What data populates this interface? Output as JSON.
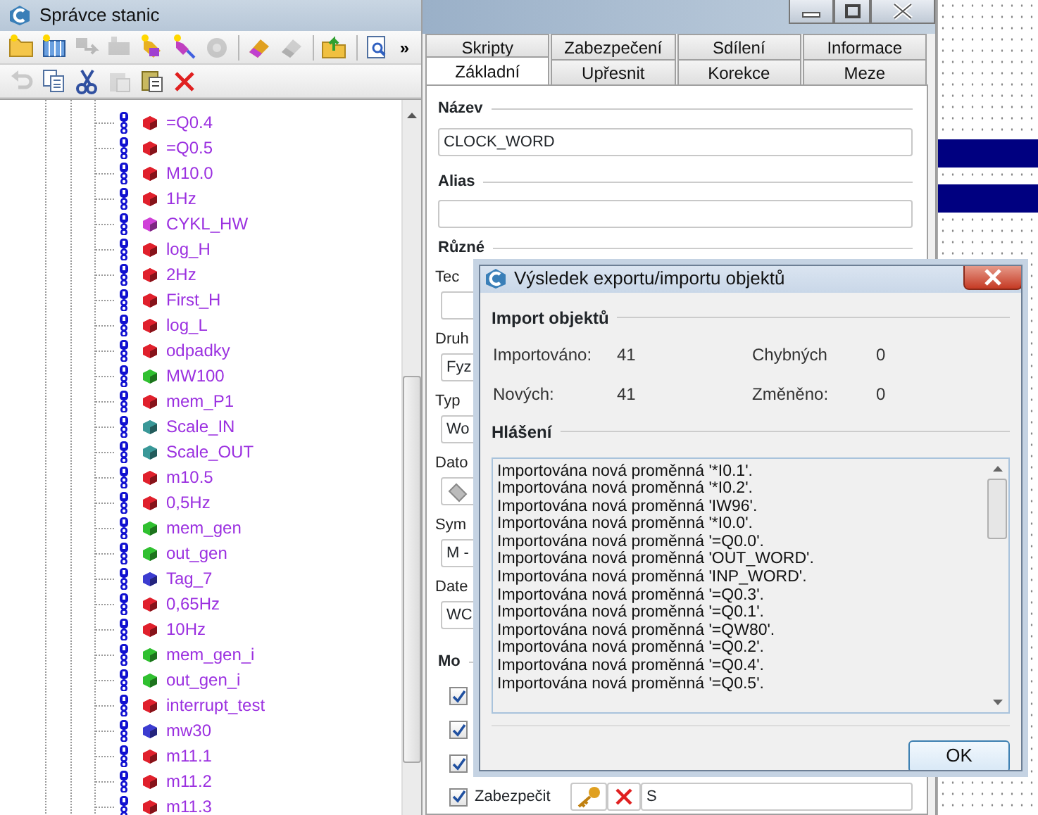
{
  "stations_window": {
    "title": "Správce stanic",
    "toolbar_1": [
      {
        "kind": "folder",
        "disabled": false
      },
      {
        "kind": "station",
        "disabled": false
      },
      {
        "kind": "transfer",
        "disabled": true
      },
      {
        "kind": "device",
        "disabled": true
      },
      {
        "kind": "tags",
        "disabled": false
      },
      {
        "kind": "tag-add",
        "disabled": false
      },
      {
        "kind": "dot",
        "disabled": true
      },
      {
        "kind": "separator"
      },
      {
        "kind": "eraser",
        "disabled": false
      },
      {
        "kind": "eraser",
        "disabled": true
      },
      {
        "kind": "separator"
      },
      {
        "kind": "open",
        "disabled": false
      },
      {
        "kind": "separator"
      },
      {
        "kind": "preview",
        "disabled": false
      },
      {
        "kind": "more",
        "text": "»"
      }
    ],
    "toolbar_2": [
      {
        "kind": "undo",
        "disabled": true
      },
      {
        "kind": "copy",
        "disabled": false
      },
      {
        "kind": "cut",
        "disabled": false
      },
      {
        "kind": "paste",
        "disabled": true
      },
      {
        "kind": "paste-special",
        "disabled": false
      },
      {
        "kind": "delete",
        "disabled": false
      }
    ],
    "tree_items": [
      {
        "label": "=Q0.4",
        "color": "#e0202c"
      },
      {
        "label": "=Q0.5",
        "color": "#e0202c"
      },
      {
        "label": "M10.0",
        "color": "#e0202c"
      },
      {
        "label": "1Hz",
        "color": "#e0202c"
      },
      {
        "label": "CYKL_HW",
        "color": "#d040d8"
      },
      {
        "label": "log_H",
        "color": "#e0202c"
      },
      {
        "label": "2Hz",
        "color": "#e0202c"
      },
      {
        "label": "First_H",
        "color": "#e0202c"
      },
      {
        "label": "log_L",
        "color": "#e0202c"
      },
      {
        "label": "odpadky",
        "color": "#e0202c"
      },
      {
        "label": "MW100",
        "color": "#30c030"
      },
      {
        "label": "mem_P1",
        "color": "#e0202c"
      },
      {
        "label": "Scale_IN",
        "color": "#3a9898"
      },
      {
        "label": "Scale_OUT",
        "color": "#3a9898"
      },
      {
        "label": "m10.5",
        "color": "#e0202c"
      },
      {
        "label": "0,5Hz",
        "color": "#e0202c"
      },
      {
        "label": "mem_gen",
        "color": "#30c030"
      },
      {
        "label": "out_gen",
        "color": "#30c030"
      },
      {
        "label": "Tag_7",
        "color": "#3c3cd0"
      },
      {
        "label": "0,65Hz",
        "color": "#e0202c"
      },
      {
        "label": "10Hz",
        "color": "#e0202c"
      },
      {
        "label": "mem_gen_i",
        "color": "#30c030"
      },
      {
        "label": "out_gen_i",
        "color": "#30c030"
      },
      {
        "label": "interrupt_test",
        "color": "#e0202c"
      },
      {
        "label": "mw30",
        "color": "#3c3cd0"
      },
      {
        "label": "m11.1",
        "color": "#e0202c"
      },
      {
        "label": "m11.2",
        "color": "#e0202c"
      },
      {
        "label": "m11.3",
        "color": "#e0202c"
      }
    ]
  },
  "properties_window": {
    "tab_rows": [
      [
        {
          "label": "Skripty",
          "selected": false
        },
        {
          "label": "Zabezpečení",
          "selected": false
        },
        {
          "label": "Sdílení",
          "selected": false
        },
        {
          "label": "Informace",
          "selected": false
        }
      ],
      [
        {
          "label": "Základní",
          "selected": true
        },
        {
          "label": "Upřesnit",
          "selected": false
        },
        {
          "label": "Korekce",
          "selected": false
        },
        {
          "label": "Meze",
          "selected": false
        }
      ]
    ],
    "name_label": "Název",
    "name_value": "CLOCK_WORD",
    "alias_label": "Alias",
    "misc_label": "Různé",
    "fields": [
      {
        "label": "Tec",
        "kind": "text"
      },
      {
        "label": "Druh",
        "kind": "text",
        "value": "Fyz"
      },
      {
        "label": "Typ",
        "kind": "text",
        "value": "Wo"
      },
      {
        "label": "Dato",
        "kind": "icon"
      },
      {
        "label": "Sym",
        "kind": "text",
        "value": "M -"
      },
      {
        "label": "Date",
        "kind": "text",
        "value": "WC"
      }
    ],
    "options_label": "Mo",
    "checkboxes": [
      {
        "checked": true
      },
      {
        "checked": true
      },
      {
        "checked": true
      }
    ],
    "protect": {
      "label": "Zabezpečit",
      "checked": true,
      "value": "S"
    }
  },
  "dialog": {
    "title": "Výsledek exportu/importu objektů",
    "group_title": "Import objektů",
    "stats": [
      {
        "label": "Importováno:",
        "value": "41"
      },
      {
        "label": "Chybných",
        "value": "0"
      },
      {
        "label": "Nových:",
        "value": "41"
      },
      {
        "label": "Změněno:",
        "value": "0"
      }
    ],
    "messages_title": "Hlášení",
    "messages": [
      "Importována nová proměnná '*I0.1'.",
      "Importována nová proměnná '*I0.2'.",
      "Importována nová proměnná 'IW96'.",
      "Importována nová proměnná '*I0.0'.",
      "Importována nová proměnná '=Q0.0'.",
      "Importována nová proměnná 'OUT_WORD'.",
      "Importována nová proměnná 'INP_WORD'.",
      "Importována nová proměnná '=Q0.3'.",
      "Importována nová proměnná '=Q0.1'.",
      "Importována nová proměnná '=QW80'.",
      "Importována nová proměnná '=Q0.2'.",
      "Importována nová proměnná '=Q0.4'.",
      "Importována nová proměnná '=Q0.5'."
    ],
    "ok_button": "OK"
  }
}
